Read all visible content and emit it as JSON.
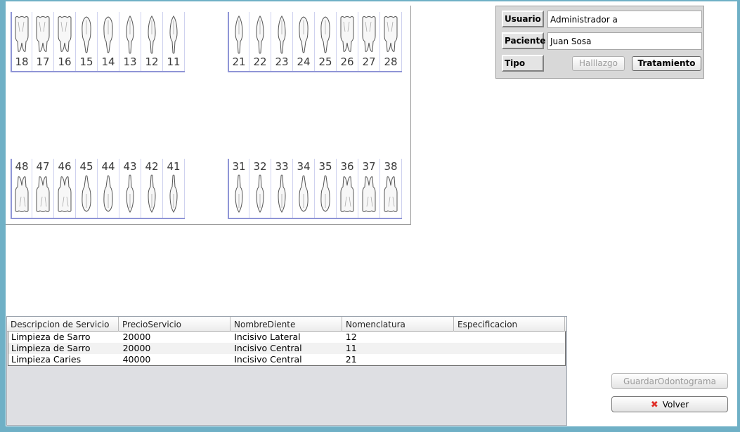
{
  "odontogram": {
    "upper_right": [
      "18",
      "17",
      "16",
      "15",
      "14",
      "13",
      "12",
      "11"
    ],
    "upper_left": [
      "21",
      "22",
      "23",
      "24",
      "25",
      "26",
      "27",
      "28"
    ],
    "lower_right": [
      "48",
      "47",
      "46",
      "45",
      "44",
      "43",
      "42",
      "41"
    ],
    "lower_left": [
      "31",
      "32",
      "33",
      "34",
      "35",
      "36",
      "37",
      "38"
    ]
  },
  "info": {
    "usuario_label": "Usuario",
    "usuario_value": "Administrador a",
    "paciente_label": "Paciente",
    "paciente_value": "Juan Sosa",
    "tipo_label": "Tipo",
    "hallazgo_label": "Halllazgo",
    "tratamiento_label": "Tratamiento"
  },
  "table": {
    "headers": [
      "Descripcion de Servicio",
      "PrecioServicio",
      "NombreDiente",
      "Nomenclatura",
      "Especificacion"
    ],
    "rows": [
      [
        "Limpieza de Sarro",
        "20000",
        "Incisivo Lateral",
        "12",
        ""
      ],
      [
        "Limpieza de Sarro",
        "20000",
        "Incisivo Central",
        "11",
        ""
      ],
      [
        "Limpieza Caries",
        "40000",
        "Incisivo Central",
        "21",
        ""
      ]
    ]
  },
  "actions": {
    "guardar_label": "GuardarOdontograma",
    "volver_label": "Volver"
  }
}
